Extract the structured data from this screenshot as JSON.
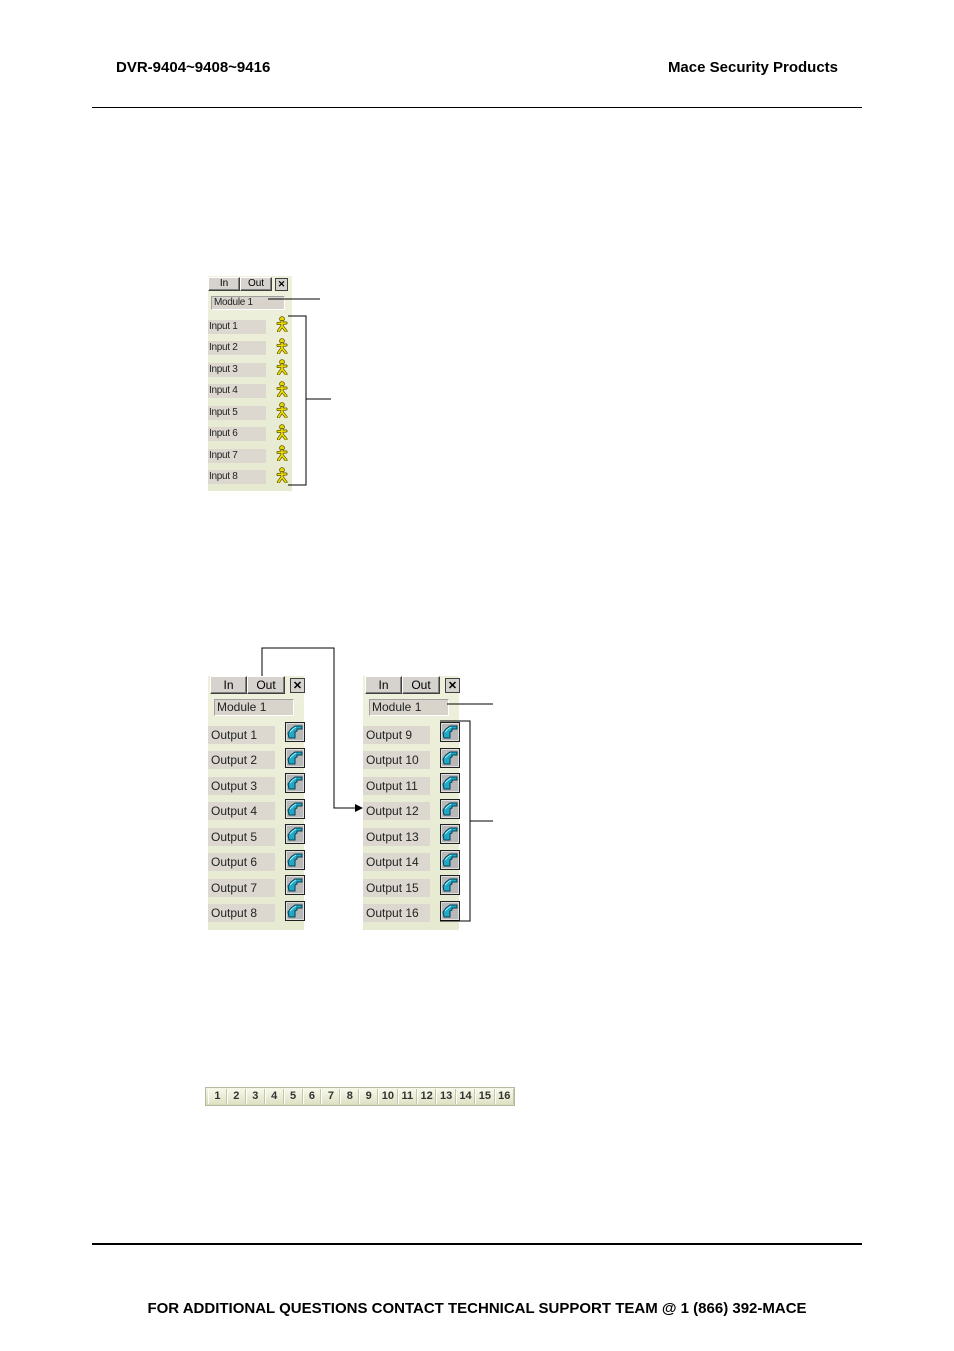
{
  "header": {
    "left": "DVR-9404~9408~9416",
    "right": "Mace Security Products"
  },
  "footer": {
    "text": "FOR ADDITIONAL QUESTIONS CONTACT TECHNICAL SUPPORT TEAM @ 1 (866) 392-MACE"
  },
  "input_panel": {
    "tabs": [
      "In",
      "Out"
    ],
    "close_icon": "close-box-icon",
    "module": "Module 1",
    "rows": [
      {
        "label": "Input 1",
        "icon": "sensor-person-icon"
      },
      {
        "label": "Input 2",
        "icon": "sensor-person-icon"
      },
      {
        "label": "Input 3",
        "icon": "sensor-person-icon"
      },
      {
        "label": "Input 4",
        "icon": "sensor-person-icon"
      },
      {
        "label": "Input 5",
        "icon": "sensor-person-icon"
      },
      {
        "label": "Input 6",
        "icon": "sensor-person-icon"
      },
      {
        "label": "Input 7",
        "icon": "sensor-person-icon"
      },
      {
        "label": "Input 8",
        "icon": "sensor-person-icon"
      }
    ]
  },
  "output_panel_1": {
    "tabs": [
      "In",
      "Out"
    ],
    "close_icon": "close-box-icon",
    "module": "Module 1",
    "rows": [
      {
        "label": "Output 1",
        "icon": "pointing-hand-icon"
      },
      {
        "label": "Output 2",
        "icon": "pointing-hand-icon"
      },
      {
        "label": "Output 3",
        "icon": "pointing-hand-icon"
      },
      {
        "label": "Output 4",
        "icon": "pointing-hand-icon"
      },
      {
        "label": "Output 5",
        "icon": "pointing-hand-icon"
      },
      {
        "label": "Output 6",
        "icon": "pointing-hand-icon"
      },
      {
        "label": "Output 7",
        "icon": "pointing-hand-icon"
      },
      {
        "label": "Output 8",
        "icon": "pointing-hand-icon"
      }
    ]
  },
  "output_panel_2": {
    "tabs": [
      "In",
      "Out"
    ],
    "close_icon": "close-box-icon",
    "module": "Module 1",
    "rows": [
      {
        "label": "Output 9",
        "icon": "pointing-hand-icon"
      },
      {
        "label": "Output 10",
        "icon": "pointing-hand-icon"
      },
      {
        "label": "Output 11",
        "icon": "pointing-hand-icon"
      },
      {
        "label": "Output 12",
        "icon": "pointing-hand-icon"
      },
      {
        "label": "Output 13",
        "icon": "pointing-hand-icon"
      },
      {
        "label": "Output 14",
        "icon": "pointing-hand-icon"
      },
      {
        "label": "Output 15",
        "icon": "pointing-hand-icon"
      },
      {
        "label": "Output 16",
        "icon": "pointing-hand-icon"
      }
    ]
  },
  "module_bar": {
    "buttons": [
      "1",
      "2",
      "3",
      "4",
      "5",
      "6",
      "7",
      "8",
      "9",
      "10",
      "11",
      "12",
      "13",
      "14",
      "15",
      "16"
    ]
  },
  "colors": {
    "panel_bg": "#e6ead0",
    "field_bg": "#dcd8d0",
    "sensor_icon": "#e8d800",
    "relay_icon": "#1fa8c8"
  }
}
